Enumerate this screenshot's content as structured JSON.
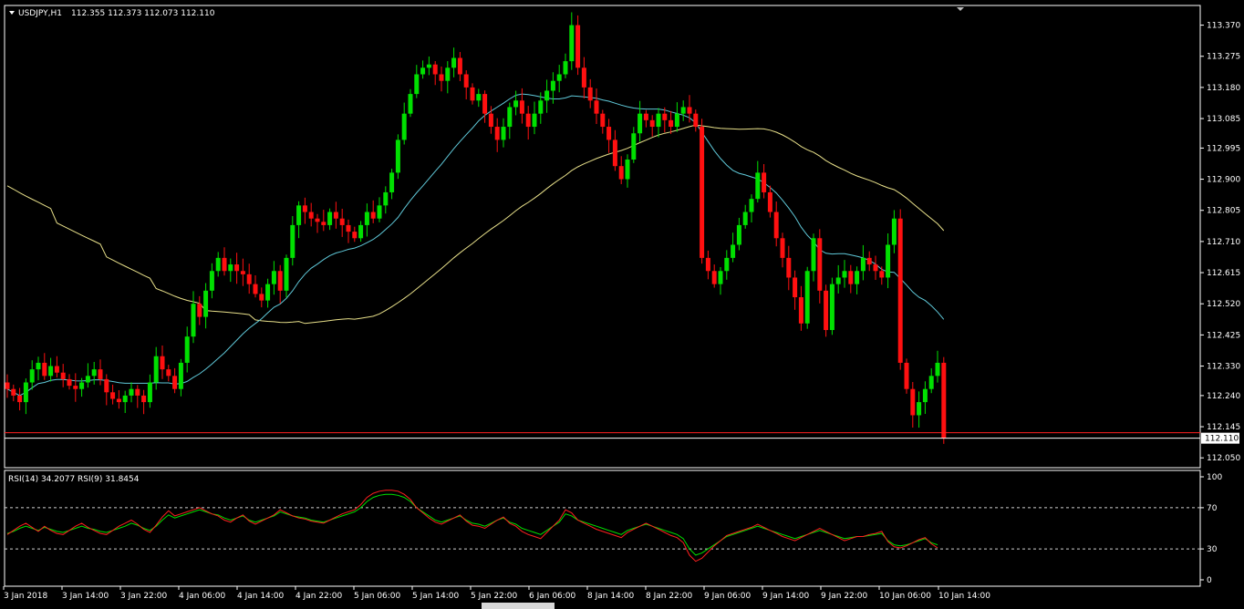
{
  "header": {
    "symbol": "USDJPY,H1",
    "ohlc": "112.355 112.373 112.073 112.110",
    "rsi_label": "RSI(14) 34.2077  RSI(9) 31.8454"
  },
  "colors": {
    "background": "#000000",
    "grid_border": "#ffffff",
    "bull": "#00e000",
    "bear": "#ff1010",
    "ma_fast": "#5fc8d8",
    "ma_slow": "#e8e08a",
    "price_line": "#ff2020",
    "rsi14": "#00e000",
    "rsi9": "#ff2020"
  },
  "chart_data": [
    {
      "type": "candlestick",
      "title": "USDJPY,H1",
      "ylim": [
        112.02,
        113.43
      ],
      "y_ticks": [
        113.37,
        113.275,
        113.18,
        113.085,
        112.995,
        112.9,
        112.805,
        112.71,
        112.615,
        112.52,
        112.425,
        112.33,
        112.24,
        112.145,
        112.05
      ],
      "y_tick_labels": [
        "113.370",
        "113.275",
        "113.180",
        "113.085",
        "112.995",
        "112.900",
        "112.805",
        "112.710",
        "112.615",
        "112.520",
        "112.425",
        "112.330",
        "112.240",
        "112.145",
        "112.050"
      ],
      "current_price": 112.11,
      "current_price_label": "112.110",
      "x_labels": [
        "3 Jan 2018",
        "3 Jan 14:00",
        "3 Jan 22:00",
        "4 Jan 06:00",
        "4 Jan 14:00",
        "4 Jan 22:00",
        "5 Jan 06:00",
        "5 Jan 14:00",
        "5 Jan 22:00",
        "6 Jan 06:00",
        "8 Jan 14:00",
        "8 Jan 22:00",
        "9 Jan 06:00",
        "9 Jan 14:00",
        "9 Jan 22:00",
        "10 Jan 06:00",
        "10 Jan 14:00"
      ],
      "close_path": [
        112.26,
        112.24,
        112.22,
        112.28,
        112.32,
        112.34,
        112.3,
        112.33,
        112.31,
        112.29,
        112.27,
        112.26,
        112.28,
        112.3,
        112.32,
        112.29,
        112.25,
        112.23,
        112.22,
        112.24,
        112.26,
        112.24,
        112.22,
        112.28,
        112.36,
        112.32,
        112.3,
        112.26,
        112.34,
        112.42,
        112.52,
        112.48,
        112.56,
        112.62,
        112.66,
        112.62,
        112.64,
        112.62,
        112.61,
        112.58,
        112.55,
        112.53,
        112.58,
        112.62,
        112.56,
        112.66,
        112.76,
        112.82,
        112.8,
        112.78,
        112.77,
        112.76,
        112.8,
        112.78,
        112.76,
        112.74,
        112.72,
        112.76,
        112.8,
        112.78,
        112.82,
        112.86,
        112.92,
        113.02,
        113.1,
        113.16,
        113.22,
        113.24,
        113.25,
        113.22,
        113.2,
        113.24,
        113.27,
        113.22,
        113.18,
        113.14,
        113.16,
        113.1,
        113.06,
        113.02,
        113.06,
        113.12,
        113.14,
        113.1,
        113.06,
        113.1,
        113.14,
        113.17,
        113.2,
        113.22,
        113.26,
        113.37,
        113.24,
        113.18,
        113.14,
        113.1,
        113.06,
        113.02,
        112.94,
        112.9,
        112.96,
        113.04,
        113.1,
        113.08,
        113.06,
        113.1,
        113.08,
        113.06,
        113.1,
        113.12,
        113.1,
        113.06,
        112.66,
        112.62,
        112.58,
        112.62,
        112.66,
        112.7,
        112.76,
        112.8,
        112.84,
        112.92,
        112.86,
        112.8,
        112.72,
        112.66,
        112.6,
        112.54,
        112.46,
        112.62,
        112.72,
        112.56,
        112.44,
        112.58,
        112.6,
        112.62,
        112.58,
        112.62,
        112.66,
        112.64,
        112.62,
        112.6,
        112.7,
        112.78,
        112.34,
        112.26,
        112.18,
        112.22,
        112.26,
        112.3,
        112.34,
        112.11
      ]
    },
    {
      "type": "line",
      "title": "RSI(14) 34.2077  RSI(9) 31.8454",
      "ylim": [
        0,
        100
      ],
      "y_ticks": [
        100,
        70,
        30,
        0
      ],
      "y_tick_labels": [
        "100",
        "70",
        "30",
        "0"
      ],
      "levels": [
        70,
        30
      ],
      "series": [
        {
          "name": "RSI(14)",
          "values": [
            45,
            47,
            50,
            52,
            50,
            48,
            51,
            49,
            47,
            46,
            48,
            50,
            52,
            50,
            49,
            47,
            46,
            48,
            50,
            52,
            55,
            53,
            50,
            48,
            52,
            58,
            63,
            60,
            62,
            64,
            66,
            68,
            66,
            64,
            63,
            60,
            58,
            60,
            62,
            58,
            56,
            58,
            60,
            62,
            66,
            64,
            62,
            61,
            60,
            58,
            57,
            56,
            58,
            60,
            62,
            64,
            66,
            70,
            76,
            80,
            82,
            83,
            83,
            82,
            80,
            76,
            70,
            66,
            62,
            58,
            56,
            58,
            60,
            62,
            58,
            55,
            54,
            52,
            55,
            58,
            60,
            56,
            54,
            50,
            48,
            46,
            44,
            48,
            52,
            56,
            64,
            62,
            58,
            56,
            54,
            52,
            50,
            48,
            46,
            44,
            48,
            50,
            52,
            54,
            52,
            50,
            48,
            46,
            44,
            40,
            30,
            24,
            26,
            30,
            34,
            38,
            42,
            44,
            46,
            48,
            50,
            52,
            50,
            48,
            46,
            44,
            42,
            40,
            42,
            44,
            46,
            48,
            46,
            44,
            42,
            40,
            41,
            42,
            42,
            43,
            44,
            45,
            38,
            34,
            33,
            34,
            36,
            38,
            40,
            36,
            34
          ]
        },
        {
          "name": "RSI(9)",
          "values": [
            44,
            48,
            52,
            55,
            51,
            47,
            52,
            48,
            45,
            44,
            48,
            52,
            55,
            51,
            48,
            45,
            44,
            48,
            52,
            55,
            58,
            54,
            49,
            46,
            53,
            61,
            67,
            62,
            64,
            66,
            68,
            70,
            67,
            64,
            62,
            58,
            56,
            60,
            63,
            57,
            54,
            57,
            60,
            63,
            68,
            65,
            62,
            60,
            59,
            57,
            56,
            55,
            58,
            61,
            64,
            66,
            68,
            73,
            80,
            84,
            86,
            87,
            87,
            86,
            83,
            78,
            70,
            65,
            60,
            56,
            54,
            57,
            60,
            63,
            57,
            53,
            52,
            50,
            54,
            58,
            61,
            55,
            52,
            47,
            44,
            42,
            40,
            46,
            52,
            58,
            68,
            65,
            58,
            55,
            52,
            49,
            47,
            45,
            43,
            41,
            46,
            49,
            52,
            55,
            52,
            49,
            46,
            43,
            41,
            36,
            24,
            18,
            21,
            27,
            33,
            38,
            43,
            45,
            47,
            49,
            51,
            54,
            51,
            48,
            45,
            42,
            40,
            38,
            41,
            44,
            47,
            50,
            47,
            44,
            41,
            38,
            40,
            42,
            42,
            44,
            45,
            47,
            37,
            32,
            31,
            33,
            36,
            39,
            41,
            35,
            31
          ]
        }
      ]
    }
  ]
}
